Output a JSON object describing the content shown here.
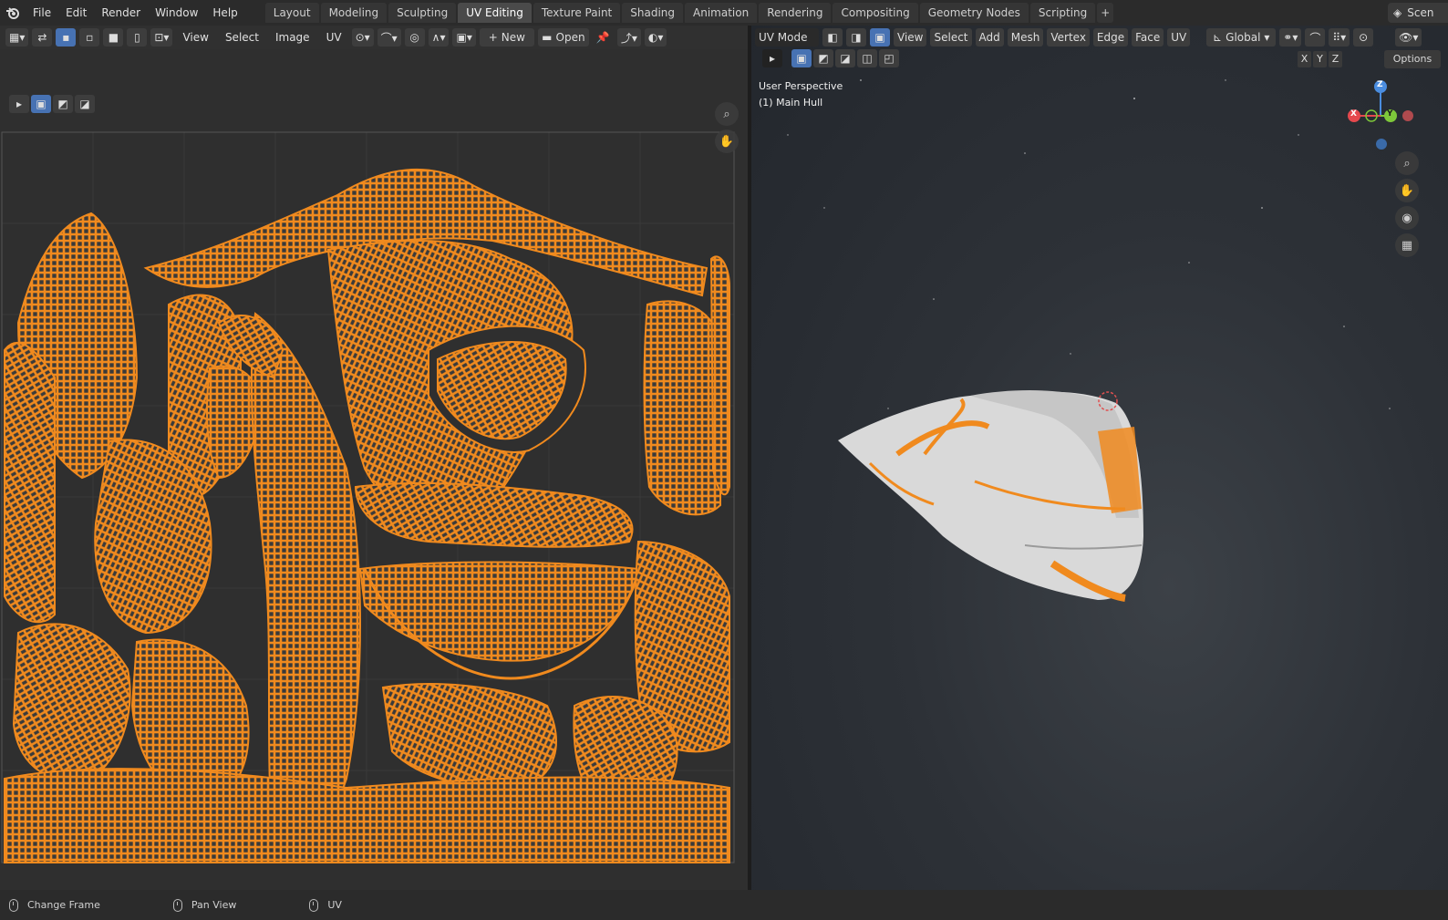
{
  "menu": [
    "File",
    "Edit",
    "Render",
    "Window",
    "Help"
  ],
  "workspaces": [
    {
      "label": "Layout",
      "active": false
    },
    {
      "label": "Modeling",
      "active": false
    },
    {
      "label": "Sculpting",
      "active": false
    },
    {
      "label": "UV Editing",
      "active": true
    },
    {
      "label": "Texture Paint",
      "active": false
    },
    {
      "label": "Shading",
      "active": false
    },
    {
      "label": "Animation",
      "active": false
    },
    {
      "label": "Rendering",
      "active": false
    },
    {
      "label": "Compositing",
      "active": false
    },
    {
      "label": "Geometry Nodes",
      "active": false
    },
    {
      "label": "Scripting",
      "active": false
    }
  ],
  "add_workspace": "+",
  "scene_label": "Scen",
  "uv_header": {
    "view": "View",
    "select": "Select",
    "image": "Image",
    "uv": "UV",
    "new_label": "New",
    "new_plus": "+",
    "open_label": "Open"
  },
  "viewport_header": {
    "mode": "UV Mode",
    "view": "View",
    "select": "Select",
    "add": "Add",
    "mesh": "Mesh",
    "vertex": "Vertex",
    "edge": "Edge",
    "face": "Face",
    "uv": "UV",
    "orientation": "Global",
    "options": "Options"
  },
  "axis_toggles": [
    "X",
    "Y",
    "Z"
  ],
  "viewport_info": {
    "perspective": "User Perspective",
    "object": "(1) Main Hull"
  },
  "gizmo_axes": [
    "X",
    "Y",
    "Z"
  ],
  "status": [
    {
      "label": "Change Frame"
    },
    {
      "label": "Pan View"
    },
    {
      "label": "UV"
    }
  ],
  "colors": {
    "uv_orange": "#f08a1e",
    "active_tab": "#4a4a4a",
    "select_blue": "#4772b3",
    "axis_x": "#e5484d",
    "axis_y": "#7ec83a",
    "axis_z": "#4a8de0"
  }
}
